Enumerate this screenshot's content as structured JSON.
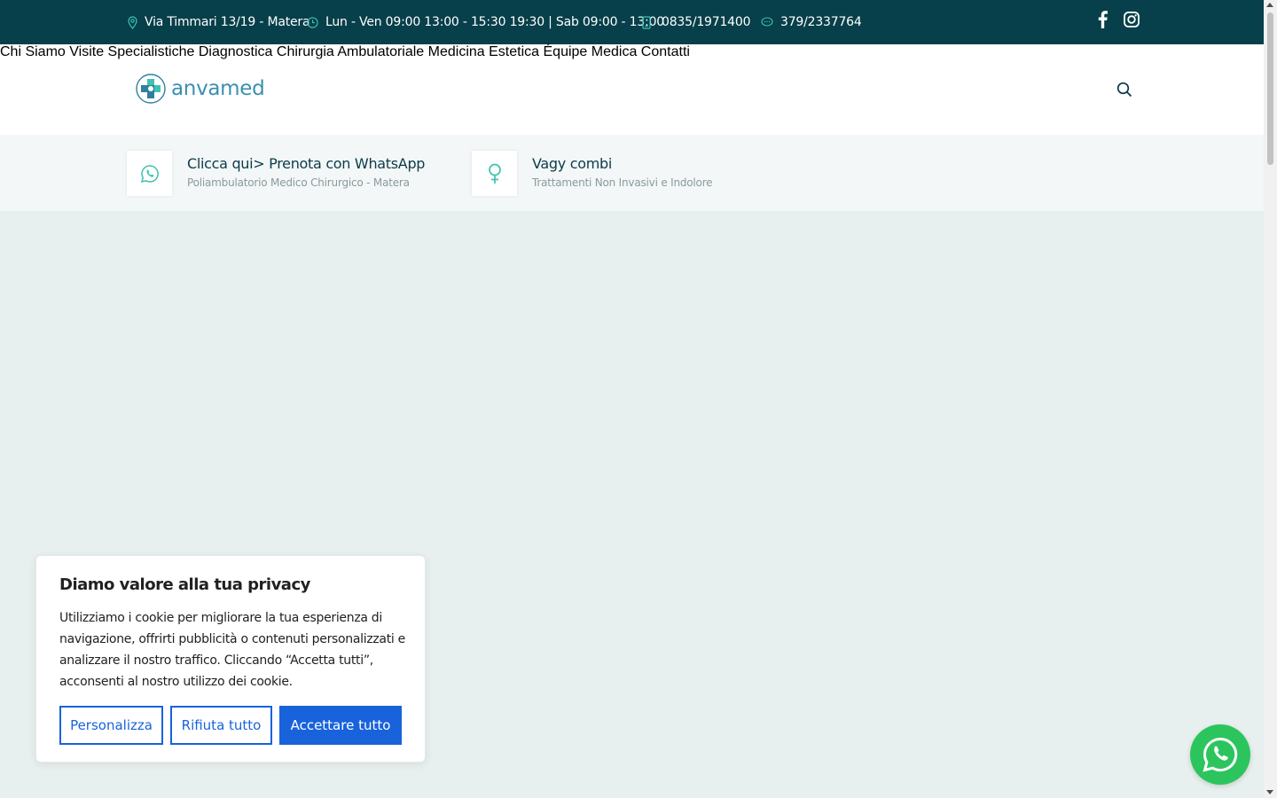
{
  "topbar": {
    "address": "Via Timmari 13/19 - Matera",
    "hours": "Lun - Ven 09:00 13:00 - 15:30 19:30 | Sab 09:00 - 13:00",
    "phone": "0835/1971400",
    "whatsapp": "379/2337764",
    "icon_color": "#3fc3b0",
    "social": [
      "facebook-icon",
      "instagram-icon"
    ]
  },
  "header": {
    "logo_text": "anvamed",
    "nav": [
      "Chi Siamo",
      "Visite Specialistiche",
      "Diagnostica",
      "Chirurgia Ambulatoriale",
      "Medicina Estetica",
      "Équipe Medica",
      "Contatti"
    ]
  },
  "features": [
    {
      "icon": "whatsapp-icon",
      "title": "Clicca qui> Prenota con WhatsApp",
      "subtitle": "Poliambulatorio Medico Chirurgico - Matera"
    },
    {
      "icon": "female-icon",
      "title": "Vagy combi",
      "subtitle": "Trattamenti Non Invasivi e Indolore"
    }
  ],
  "cookie": {
    "title": "Diamo valore alla tua privacy",
    "body": "Utilizziamo i cookie per migliorare la tua esperienza di navigazione, offrirti pubblicità o contenuti personalizzati e analizzare il nostro traffico. Cliccando “Accetta tutti”, acconsenti al nostro utilizzo dei cookie.",
    "customize": "Personalizza",
    "reject": "Rifiuta tutto",
    "accept": "Accettare tutto",
    "accent": "#1863dc"
  },
  "colors": {
    "topbar_bg": "#073f4a",
    "whatsapp_green": "#2cc55d",
    "teal": "#3fc3b0"
  }
}
